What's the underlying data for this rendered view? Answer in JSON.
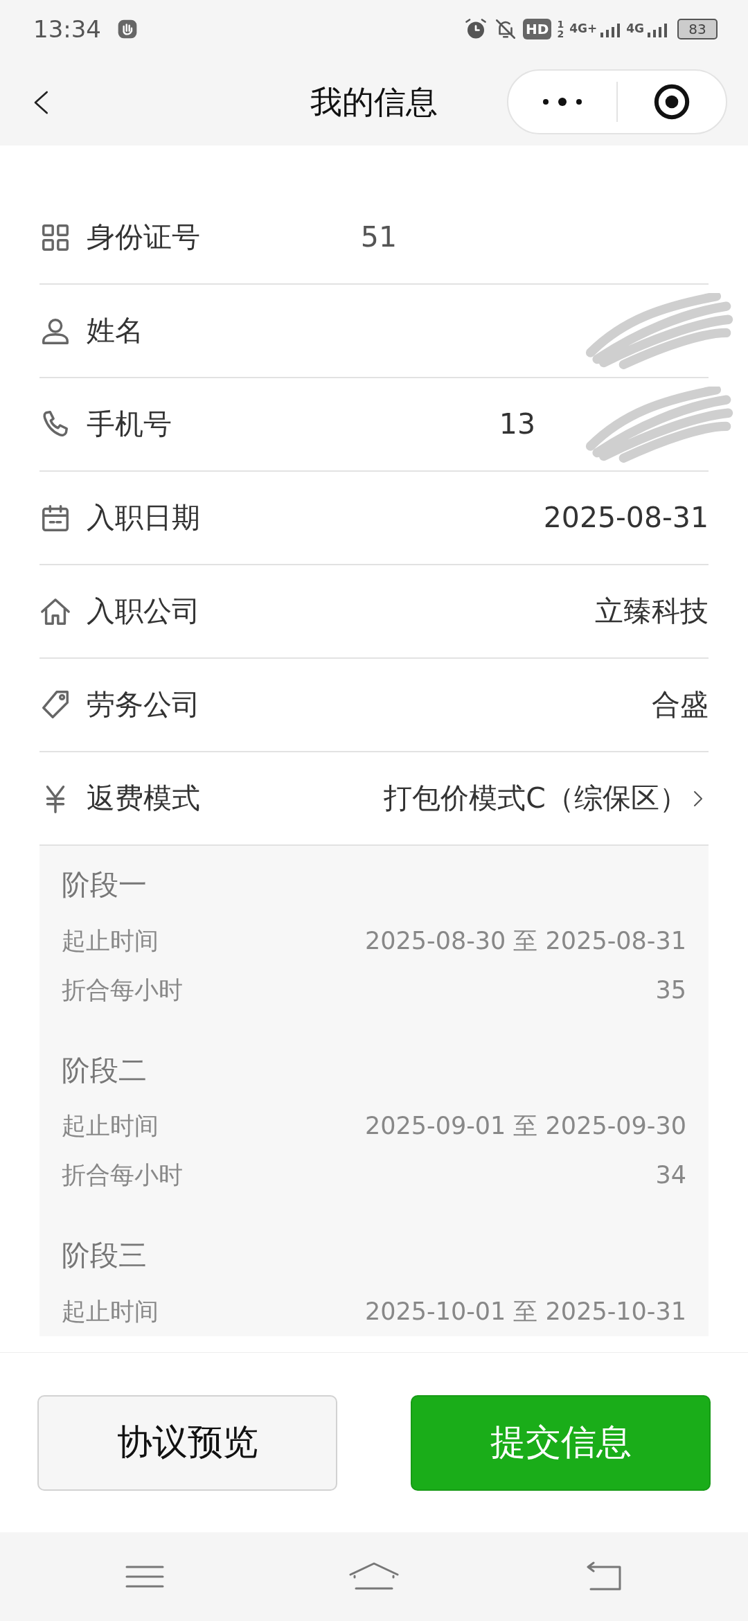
{
  "status_bar": {
    "time": "13:34",
    "hd": "HD",
    "sim_slots": [
      "1",
      "2"
    ],
    "network_1": "4G+",
    "network_2": "4G",
    "battery": "83"
  },
  "nav": {
    "title": "我的信息"
  },
  "fields": [
    {
      "kind": "id",
      "label": "身份证号",
      "value": "51",
      "faded": true
    },
    {
      "kind": "person",
      "label": "姓名",
      "scribbled": true
    },
    {
      "kind": "phone",
      "label": "手机号",
      "value": "13",
      "scribbled": true
    },
    {
      "kind": "calendar",
      "label": "入职日期",
      "value": "2025-08-31"
    },
    {
      "kind": "home",
      "label": "入职公司",
      "value": "立臻科技"
    },
    {
      "kind": "tag",
      "label": "劳务公司",
      "value": "合盛"
    },
    {
      "kind": "yuan",
      "label": "返费模式",
      "value": "打包价模式C（综保区）",
      "link": true
    }
  ],
  "stages": [
    {
      "title": "阶段一",
      "rows": [
        {
          "label": "起止时间",
          "value": "2025-08-30 至 2025-08-31"
        },
        {
          "label": "折合每小时",
          "value": "35"
        }
      ]
    },
    {
      "title": "阶段二",
      "rows": [
        {
          "label": "起止时间",
          "value": "2025-09-01 至 2025-09-30"
        },
        {
          "label": "折合每小时",
          "value": "34"
        }
      ]
    },
    {
      "title": "阶段三",
      "rows": [
        {
          "label": "起止时间",
          "value": "2025-10-01 至 2025-10-31"
        }
      ]
    }
  ],
  "buttons": [
    {
      "kind": "secondary",
      "label": "协议预览"
    },
    {
      "kind": "primary",
      "label": "提交信息"
    }
  ]
}
